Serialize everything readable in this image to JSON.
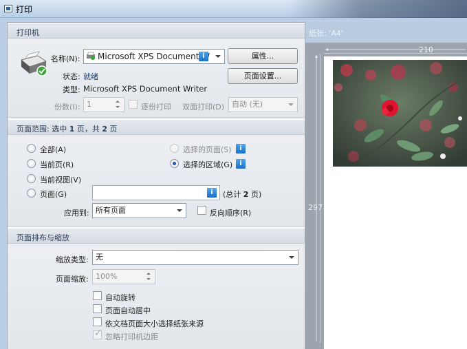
{
  "window": {
    "title": "打印"
  },
  "printer_section": {
    "title": "打印机",
    "name_label": "名称(N):",
    "name_value": "Microsoft XPS Document W",
    "properties_button": "属性...",
    "page_setup_button": "页面设置...",
    "status_label": "状态:",
    "status_value": "就绪",
    "type_label": "类型:",
    "type_value": "Microsoft XPS Document Writer",
    "copies_label": "份数(I):",
    "copies_value": "1",
    "collate_label": "逐份打印",
    "duplex_label": "双面打印(D)",
    "duplex_value": "自动 (无)"
  },
  "range_section": {
    "title_prefix": "页面范围: 选中 ",
    "title_sel": "1",
    "title_mid": " 页，共 ",
    "title_total": "2",
    "title_suffix": " 页",
    "all": "全部(A)",
    "current_page": "当前页(R)",
    "current_view": "当前视图(V)",
    "pages": "页面(G)",
    "selected_pages": "选择的页面(S)",
    "selected_area": "选择的区域(G)",
    "pages_value": "",
    "total_prefix": "(总计 ",
    "total_num": "2",
    "total_suffix": " 页)",
    "apply_to_label": "应用到:",
    "apply_to_value": "所有页面",
    "reverse_label": "反向顺序(R)"
  },
  "layout_section": {
    "title": "页面排布与缩放",
    "scale_type_label": "缩放类型:",
    "scale_type_value": "无",
    "page_scale_label": "页面缩放:",
    "page_scale_value": "100%",
    "auto_rotate": "自动旋转",
    "auto_center": "页面自动居中",
    "paper_source": "依文档页面大小选择纸张来源",
    "ignore_margins": "忽略打印机边距"
  },
  "preview": {
    "paper_label": "纸张: 'A4'",
    "width": "210",
    "height": "297"
  },
  "states": {
    "selected_range": "选择的区域(G)",
    "ignore_margins_checked": true
  },
  "colors": {
    "accent": "#1d56b5",
    "info_icon": "#2b7fd3",
    "section_title": "#2a3a52"
  }
}
